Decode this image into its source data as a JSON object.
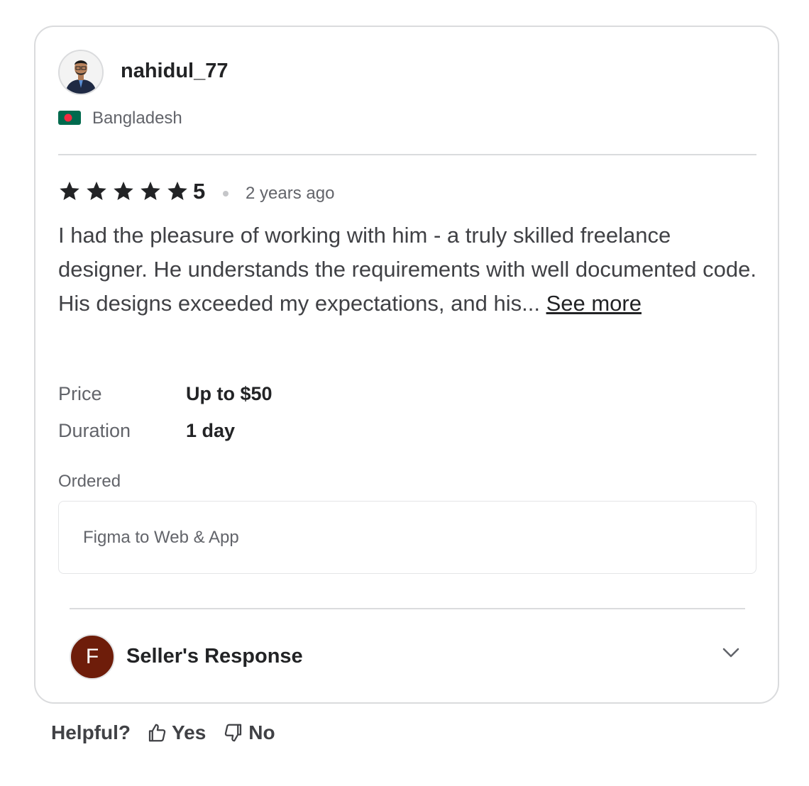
{
  "reviewer": {
    "username": "nahidul_77",
    "country": "Bangladesh"
  },
  "review": {
    "rating": "5",
    "stars": 5,
    "time_ago": "2 years ago",
    "text": "I had the pleasure of working with him - a truly skilled freelance designer. He understands the requirements with well documented code. His designs exceeded my expectations, and his...",
    "see_more": "See more"
  },
  "details": {
    "price_label": "Price",
    "price_value": "Up to $50",
    "duration_label": "Duration",
    "duration_value": "1 day"
  },
  "ordered": {
    "label": "Ordered",
    "item": "Figma to Web & App"
  },
  "seller_response": {
    "avatar_letter": "F",
    "title": "Seller's Response"
  },
  "helpful": {
    "question": "Helpful?",
    "yes": "Yes",
    "no": "No"
  },
  "colors": {
    "star": "#222325",
    "seller_avatar": "#6e1d0a",
    "flag_green": "#006a4e",
    "flag_red": "#f42a41"
  },
  "icons": {
    "flag": "bangladesh-flag-icon",
    "star": "star-icon",
    "chevron": "chevron-down-icon",
    "yes": "thumbs-up-icon",
    "no": "thumbs-down-icon"
  }
}
